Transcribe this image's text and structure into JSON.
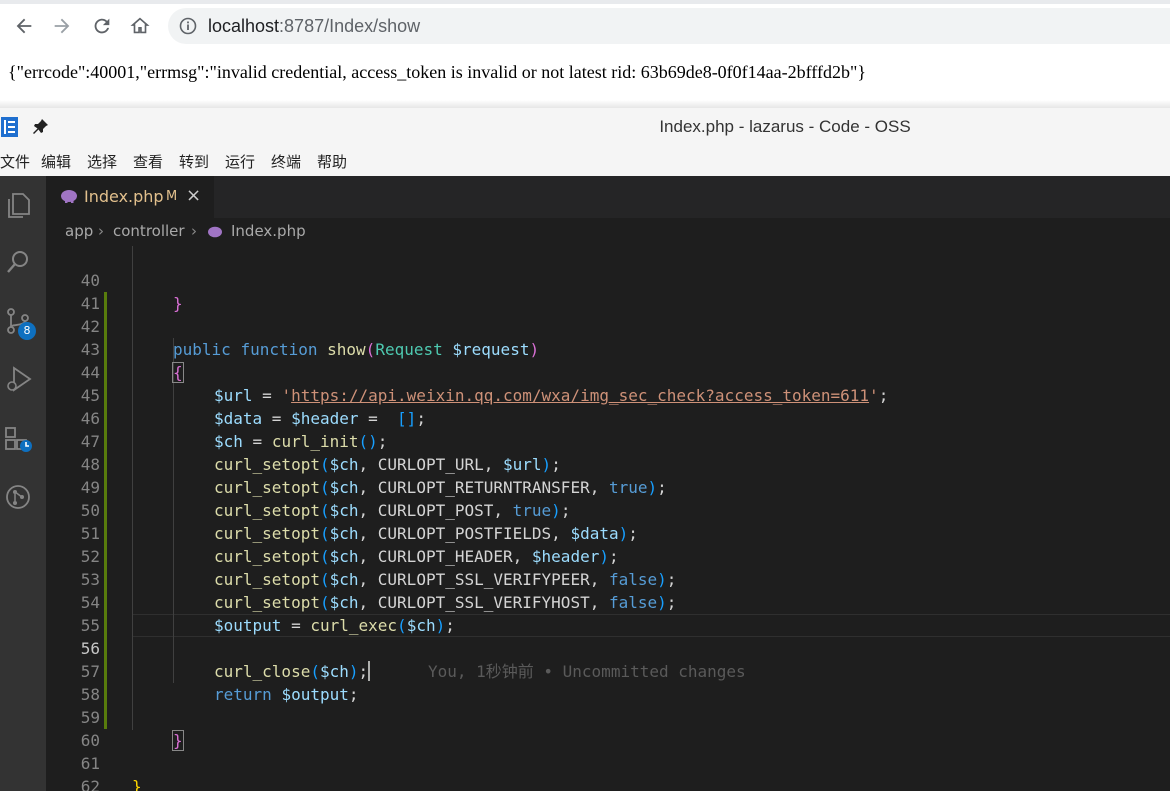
{
  "browser": {
    "url_host": "localhost",
    "url_rest": ":8787/Index/show",
    "response_json": "{\"errcode\":40001,\"errmsg\":\"invalid credential, access_token is invalid or not latest rid: 63b69de8-0f0f14aa-2bfffd2b\"}"
  },
  "editor_window": {
    "title": "Index.php - lazarus - Code - OSS",
    "menu": [
      "文件",
      "编辑",
      "选择",
      "查看",
      "转到",
      "运行",
      "终端",
      "帮助"
    ],
    "scm_badge": "8",
    "tab": {
      "name": "Index.php",
      "status": "M",
      "close": "×"
    },
    "breadcrumbs": [
      "app",
      "controller",
      "Index.php"
    ],
    "line_numbers": [
      "40",
      "41",
      "42",
      "43",
      "44",
      "45",
      "46",
      "47",
      "48",
      "49",
      "50",
      "51",
      "52",
      "53",
      "54",
      "55",
      "56",
      "57",
      "58",
      "59",
      "60",
      "61",
      "62"
    ],
    "code": {
      "l40": "}",
      "l42": {
        "kw1": "public",
        "kw2": "function",
        "fn": "show",
        "type": "Request",
        "param": "$request"
      },
      "l43": "{",
      "l44": {
        "var": "$url",
        "op": " = ",
        "q1": "'",
        "url": "https://api.weixin.qq.com/wxa/img_sec_check?access_token=611",
        "q2": "'",
        "end": ";"
      },
      "l45": {
        "v1": "$data",
        "op1": " = ",
        "v2": "$header",
        "op2": " =  ",
        "arr": "[]",
        "end": ";"
      },
      "l46": {
        "var": "$ch",
        "op": " = ",
        "fn": "curl_init",
        "p": "()",
        "end": ";"
      },
      "setopts": [
        {
          "fn": "curl_setopt",
          "var": "$ch",
          "opt": "CURLOPT_URL",
          "val": "$url",
          "val_kind": "var"
        },
        {
          "fn": "curl_setopt",
          "var": "$ch",
          "opt": "CURLOPT_RETURNTRANSFER",
          "val": "true",
          "val_kind": "kw"
        },
        {
          "fn": "curl_setopt",
          "var": "$ch",
          "opt": "CURLOPT_POST",
          "val": "true",
          "val_kind": "kw"
        },
        {
          "fn": "curl_setopt",
          "var": "$ch",
          "opt": "CURLOPT_POSTFIELDS",
          "val": "$data",
          "val_kind": "var"
        },
        {
          "fn": "curl_setopt",
          "var": "$ch",
          "opt": "CURLOPT_HEADER",
          "val": "$header",
          "val_kind": "var"
        },
        {
          "fn": "curl_setopt",
          "var": "$ch",
          "opt": "CURLOPT_SSL_VERIFYPEER",
          "val": "false",
          "val_kind": "kw"
        },
        {
          "fn": "curl_setopt",
          "var": "$ch",
          "opt": "CURLOPT_SSL_VERIFYHOST",
          "val": "false",
          "val_kind": "kw"
        }
      ],
      "l54": {
        "var": "$output",
        "op": " = ",
        "fn": "curl_exec",
        "arg": "$ch",
        "end": ";"
      },
      "l56": {
        "fn": "curl_close",
        "arg": "$ch",
        "end": ";",
        "blame": "You, 1秒钟前 • Uncommitted changes"
      },
      "l57": {
        "kw": "return",
        "var": "$output",
        "end": ";"
      },
      "l59": "}",
      "l61": "}"
    }
  }
}
